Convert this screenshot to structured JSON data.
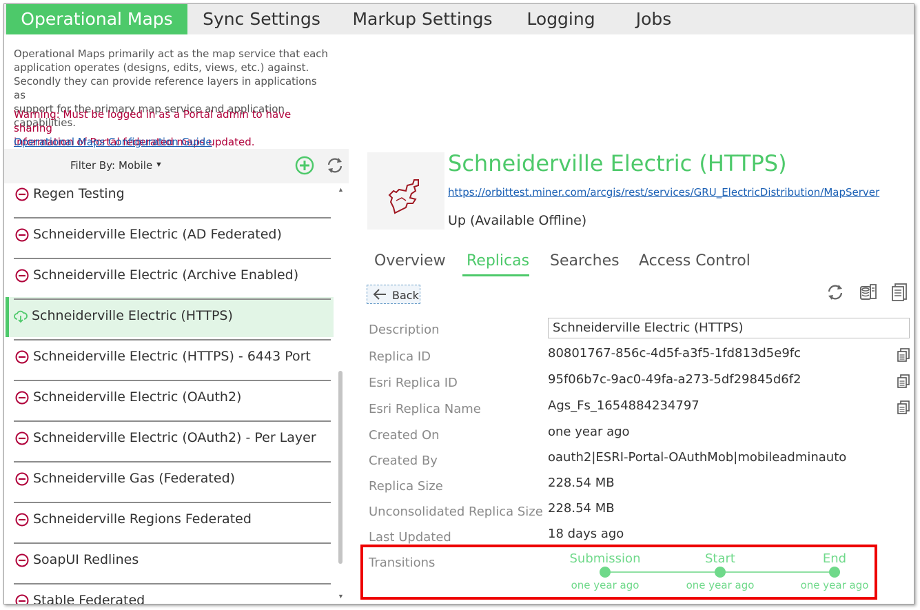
{
  "tabs": [
    {
      "label": "Operational Maps",
      "active": true
    },
    {
      "label": "Sync Settings",
      "active": false
    },
    {
      "label": "Markup Settings",
      "active": false
    },
    {
      "label": "Logging",
      "active": false
    },
    {
      "label": "Jobs",
      "active": false
    }
  ],
  "intro": {
    "line1": "Operational Maps primarily act as the map service that each",
    "line2": "application operates (designs, edits, views, etc.) against.",
    "line3": "Secondly they can provide reference layers in applications as",
    "line4": "support for the primary map service and application capabilities.",
    "warning1": "Warning: Must be logged in as a Portal admin to have sharing",
    "warning2": "information of Portal federated maps updated.",
    "guide_link": "Operational Maps Configuration Guide"
  },
  "filter": {
    "label": "Filter By:",
    "value": "Mobile",
    "add_icon": "add-circle-icon",
    "refresh_icon": "refresh-icon"
  },
  "maps": [
    {
      "label": "Regen Testing",
      "icon": "remove-circle-icon",
      "selected": false
    },
    {
      "label": "Schneiderville Electric (AD Federated)",
      "icon": "remove-circle-icon",
      "selected": false
    },
    {
      "label": "Schneiderville Electric (Archive Enabled)",
      "icon": "remove-circle-icon",
      "selected": false
    },
    {
      "label": "Schneiderville Electric (HTTPS)",
      "icon": "cloud-download-icon",
      "selected": true
    },
    {
      "label": "Schneiderville Electric (HTTPS) - 6443 Port",
      "icon": "remove-circle-icon",
      "selected": false
    },
    {
      "label": "Schneiderville Electric (OAuth2)",
      "icon": "remove-circle-icon",
      "selected": false
    },
    {
      "label": "Schneiderville Electric (OAuth2) - Per Layer",
      "icon": "remove-circle-icon",
      "selected": false
    },
    {
      "label": "Schneiderville Gas (Federated)",
      "icon": "remove-circle-icon",
      "selected": false
    },
    {
      "label": "Schneiderville Regions Federated",
      "icon": "remove-circle-icon",
      "selected": false
    },
    {
      "label": "SoapUI Redlines",
      "icon": "remove-circle-icon",
      "selected": false
    },
    {
      "label": "Stable Federated",
      "icon": "remove-circle-icon",
      "selected": false
    }
  ],
  "detail": {
    "title": "Schneiderville Electric (HTTPS)",
    "url": "https://orbittest.miner.com/arcgis/rest/services/GRU_ElectricDistribution/MapServer",
    "status": "Up (Available Offline)",
    "subtabs": [
      {
        "label": "Overview",
        "active": false
      },
      {
        "label": "Replicas",
        "active": true
      },
      {
        "label": "Searches",
        "active": false
      },
      {
        "label": "Access Control",
        "active": false
      }
    ],
    "back_label": "Back",
    "toolbar_icons": [
      "refresh-icon",
      "database-icon",
      "report-icon"
    ]
  },
  "replica": {
    "description_label": "Description",
    "description_value": "Schneiderville Electric (HTTPS)",
    "fields": [
      {
        "label": "Replica ID",
        "value": "80801767-856c-4d5f-a3f5-1fd813d5e9fc",
        "copy": true
      },
      {
        "label": "Esri Replica ID",
        "value": "95f06b7c-9ac0-49fa-a273-5df29845d6f2",
        "copy": true
      },
      {
        "label": "Esri Replica Name",
        "value": "Ags_Fs_1654884234797",
        "copy": true
      },
      {
        "label": "Created On",
        "value": "one year ago",
        "copy": false
      },
      {
        "label": "Created By",
        "value": "oauth2|ESRI-Portal-OAuthMob|mobileadminauto",
        "copy": false
      },
      {
        "label": "Replica Size",
        "value": "228.54 MB",
        "copy": false
      },
      {
        "label": "Unconsolidated Replica Size",
        "value": "228.54 MB",
        "copy": false
      },
      {
        "label": "Last Updated",
        "value": "18 days ago",
        "copy": false
      }
    ],
    "transitions_label": "Transitions",
    "transitions": [
      {
        "label": "Submission",
        "time": "one year ago"
      },
      {
        "label": "Start",
        "time": "one year ago"
      },
      {
        "label": "End",
        "time": "one year ago"
      }
    ]
  },
  "colors": {
    "accent": "#4dc96a",
    "warning": "#b0003a",
    "link": "#1a5fb4",
    "remove_icon": "#b0003a",
    "highlight_box": "#ee0000"
  }
}
